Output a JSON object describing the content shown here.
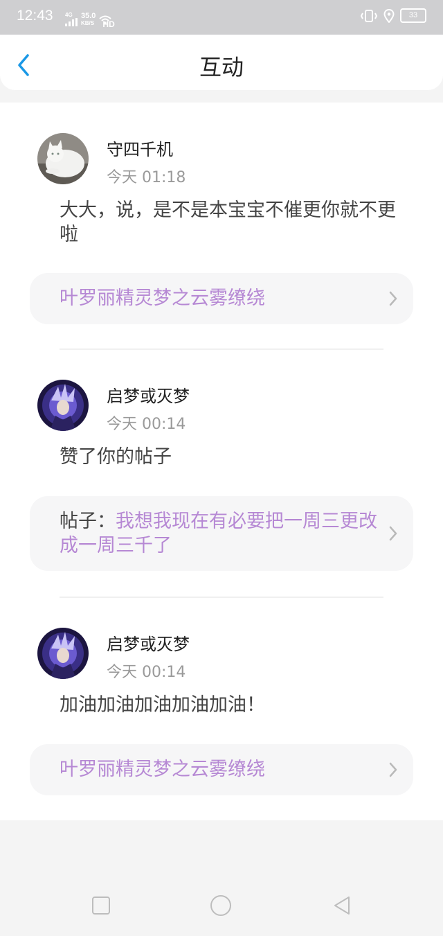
{
  "status_bar": {
    "time": "12:43",
    "network_type": "4G",
    "speed": "35.0",
    "speed_unit": "KB/S",
    "hd": "HD",
    "battery": "33"
  },
  "header": {
    "title": "互动",
    "back_icon": "chevron-left-icon"
  },
  "colors": {
    "accent": "#1a98e6",
    "link": "#b688d4",
    "secondary_text": "#9a9a9a"
  },
  "items": [
    {
      "username": "守四千机",
      "time": "今天 01:18",
      "message": "大大，说，是不是本宝宝不催更你就不更啦",
      "link_prefix": "",
      "link_text": "叶罗丽精灵梦之云雾缭绕"
    },
    {
      "username": "启梦或灭梦",
      "time": "今天 00:14",
      "message": "赞了你的帖子",
      "link_prefix": "帖子：",
      "link_text": "我想我现在有必要把一周三更改成一周三千了"
    },
    {
      "username": "启梦或灭梦",
      "time": "今天 00:14",
      "message": "加油加油加油加油加油！",
      "link_prefix": "",
      "link_text": "叶罗丽精灵梦之云雾缭绕"
    }
  ],
  "nav": {
    "recent_icon": "square-icon",
    "home_icon": "circle-icon",
    "back_icon": "triangle-back-icon"
  }
}
